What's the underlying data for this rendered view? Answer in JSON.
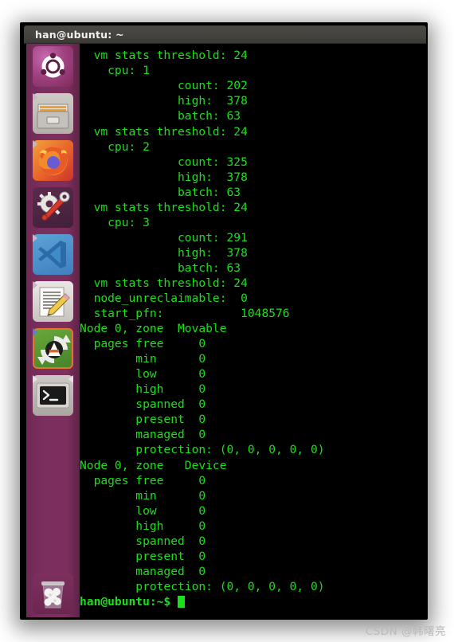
{
  "window": {
    "title": "han@ubuntu: ~"
  },
  "watermark": {
    "text": "CSDN @韩曙亮"
  },
  "launcher": {
    "items": [
      {
        "name": "ubuntu-dash",
        "label": "Ubuntu",
        "selected": false
      },
      {
        "name": "files",
        "label": "Files",
        "selected": true
      },
      {
        "name": "firefox",
        "label": "Firefox",
        "selected": true
      },
      {
        "name": "system-tools",
        "label": "System Tools",
        "selected": false
      },
      {
        "name": "vscode",
        "label": "Visual Studio Code",
        "selected": true
      },
      {
        "name": "text-editor",
        "label": "Text Editor",
        "selected": true
      },
      {
        "name": "software-updater",
        "label": "Software Updater",
        "selected": true
      },
      {
        "name": "terminal",
        "label": "Terminal",
        "selected": true
      },
      {
        "name": "trash",
        "label": "Trash",
        "selected": false
      }
    ]
  },
  "terminal": {
    "prompt": "han@ubuntu:~$ ",
    "foreground": "#19e019",
    "background": "#000000",
    "lines": [
      "  vm stats threshold: 24",
      "    cpu: 1",
      "              count: 202",
      "              high:  378",
      "              batch: 63",
      "  vm stats threshold: 24",
      "    cpu: 2",
      "              count: 325",
      "              high:  378",
      "              batch: 63",
      "  vm stats threshold: 24",
      "    cpu: 3",
      "              count: 291",
      "              high:  378",
      "              batch: 63",
      "  vm stats threshold: 24",
      "  node_unreclaimable:  0",
      "  start_pfn:           1048576",
      "Node 0, zone  Movable",
      "  pages free     0",
      "        min      0",
      "        low      0",
      "        high     0",
      "        spanned  0",
      "        present  0",
      "        managed  0",
      "        protection: (0, 0, 0, 0, 0)",
      "Node 0, zone   Device",
      "  pages free     0",
      "        min      0",
      "        low      0",
      "        high     0",
      "        spanned  0",
      "        present  0",
      "        managed  0",
      "        protection: (0, 0, 0, 0, 0)"
    ]
  }
}
